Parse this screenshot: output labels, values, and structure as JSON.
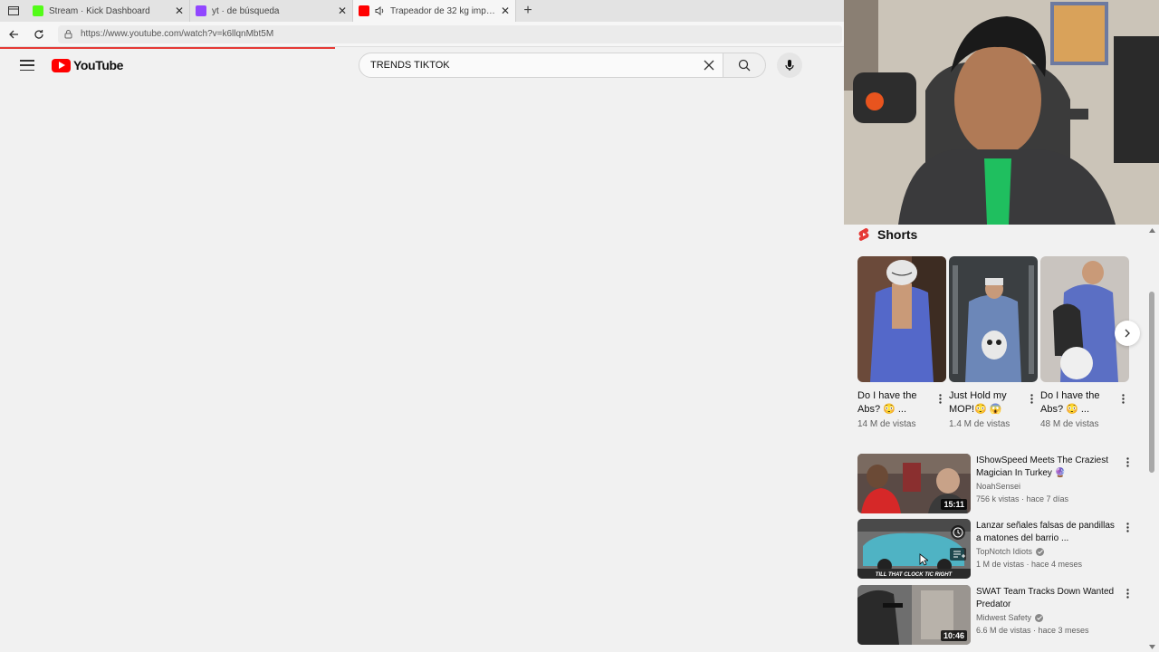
{
  "browser": {
    "tabs": [
      {
        "title": "Stream · Kick Dashboard",
        "icon": "kick-icon",
        "color": "#53fc18"
      },
      {
        "title": "yt · de búsqueda",
        "icon": "twitch-icon",
        "color": "#9146ff"
      },
      {
        "title": "Trapeador de 32 kg impacta",
        "icon": "youtube-icon",
        "color": "#ff0000"
      }
    ],
    "url": "https://www.youtube.com/watch?v=k6llqnMbt5M"
  },
  "youtube": {
    "logo_text": "YouTube",
    "search_value": "TRENDS TIKTOK"
  },
  "shorts": {
    "heading": "Shorts",
    "items": [
      {
        "title": "Do I have the Abs? 😳 ...",
        "views": "14 M de vistas"
      },
      {
        "title": "Just Hold my MOP!😳 😱",
        "views": "1.4 M de vistas"
      },
      {
        "title": "Do I have the Abs? 😳 ...",
        "views": "48 M de vistas"
      }
    ]
  },
  "videos": [
    {
      "title": "IShowSpeed Meets The Craziest Magician In Turkey 🔮",
      "channel": "NoahSensei",
      "verified": false,
      "meta": "756 k vistas · hace 7 días",
      "duration": "15:11"
    },
    {
      "title": "Lanzar señales falsas de pandillas a matones del barrio ...",
      "channel": "TopNotch Idiots",
      "verified": true,
      "meta": "1 M de vistas · hace 4 meses",
      "duration": "",
      "overlay_text": "TILL THAT CLOCK TIC RIGHT"
    },
    {
      "title": "SWAT Team Tracks Down Wanted Predator",
      "channel": "Midwest Safety",
      "verified": true,
      "meta": "6.6 M de vistas · hace 3 meses",
      "duration": "10:46"
    }
  ]
}
